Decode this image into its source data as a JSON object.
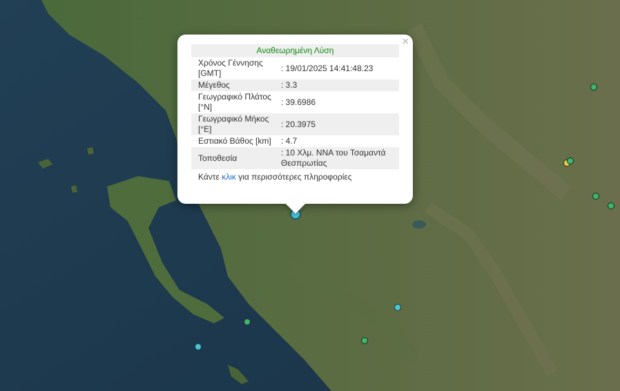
{
  "popup": {
    "title": "Αναθεωρημένη Λύση",
    "rows": [
      {
        "label": "Χρόνος Γέννησης [GMT]",
        "value": ": 19/01/2025 14:41:48.23"
      },
      {
        "label": "Μέγεθος",
        "value": ": 3.3"
      },
      {
        "label": "Γεωγραφικό Πλάτος [°N]",
        "value": ": 39.6986"
      },
      {
        "label": "Γεωγραφικό Μήκος [°E]",
        "value": ": 20.3975"
      },
      {
        "label": "Εστιακό Βάθος [km]",
        "value": ": 4.7"
      },
      {
        "label": "Τοποθεσία",
        "value": ": 10 Χλμ. ΝΝΑ του Τσαμαντά Θεσπρωτίας"
      }
    ],
    "more_prefix": "Κάντε ",
    "more_link": "κλικ",
    "more_suffix": " για περισσότερες πληροφορίες",
    "close_glyph": "×"
  },
  "colors": {
    "sea": "#1f3a4e",
    "land": "#3d5a34",
    "marker_green": "#3fb56f",
    "marker_cyan": "#49c6d6",
    "marker_yellow": "#e5d04a",
    "title_green": "#118811",
    "link_blue": "#1a6fd0"
  }
}
